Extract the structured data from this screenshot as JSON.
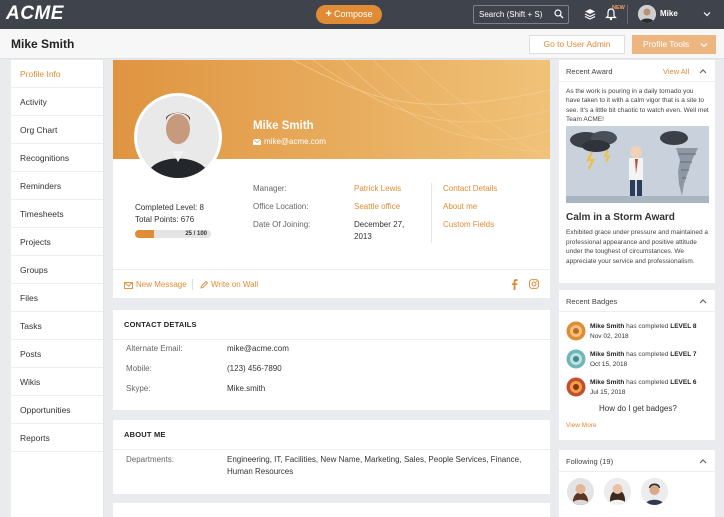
{
  "topbar": {
    "logo": "ACME",
    "compose_label": "Compose",
    "search_placeholder": "Search (Shift + S)",
    "new_badge": "NEW",
    "user_name": "Mike"
  },
  "header": {
    "title": "Mike Smith",
    "goto_admin": "Go to User Admin",
    "profile_tools": "Profile Tools"
  },
  "sidebar": {
    "items": [
      "Profile Info",
      "Activity",
      "Org Chart",
      "Recognitions",
      "Reminders",
      "Timesheets",
      "Projects",
      "Groups",
      "Files",
      "Tasks",
      "Posts",
      "Wikis",
      "Opportunities",
      "Reports"
    ],
    "active_index": 0
  },
  "profile": {
    "name": "Mike Smith",
    "email": "mike@acme.com",
    "completed_level": "Completed Level: 8",
    "total_points": "Total Points: 676",
    "progress_label": "25 / 100",
    "progress_fraction": 0.25,
    "manager_label": "Manager:",
    "manager_value": "Patrick Lewis",
    "office_label": "Office Location:",
    "office_value": "Seattle office",
    "joining_label": "Date Of Joining:",
    "joining_value": "December 27, 2013",
    "links": [
      "Contact Details",
      "About me",
      "Custom Fields"
    ],
    "new_message": "New Message",
    "write_on_wall": "Write on Wall"
  },
  "contact": {
    "title": "CONTACT DETAILS",
    "rows": [
      {
        "label": "Alternate Email:",
        "value": "mike@acme.com"
      },
      {
        "label": "Mobile:",
        "value": "(123) 456-7890"
      },
      {
        "label": "Skype:",
        "value": "Mike.smith"
      }
    ]
  },
  "about": {
    "title": "ABOUT ME",
    "departments_label": "Departments:",
    "departments_value": "Engineering, IT, Facilities, New Name, Marketing, Sales, People Services, Finance, Human Resources"
  },
  "recent_award": {
    "title": "Recent Award",
    "view_all": "View All",
    "text": "As the work is pouring in a daily tornado you have taken to it with a calm vigor that is a site to see. It's a little bit chaotic to watch even. Well met Team ACME!",
    "award_name": "Calm in a Storm Award",
    "award_desc": "Exhibited grace under pressure and maintained a professional appearance and positive attitude under the toughest of circumstances. We appreciate your service and professionalism."
  },
  "recent_badges": {
    "title": "Recent Badges",
    "has_completed": "has completed",
    "items": [
      {
        "name": "Mike Smith",
        "level": "LEVEL 8",
        "date": "Nov 02, 2018",
        "color": "#e08c37"
      },
      {
        "name": "Mike Smith",
        "level": "LEVEL 7",
        "date": "Oct 15, 2018",
        "color": "#6fb6b8"
      },
      {
        "name": "Mike Smith",
        "level": "LEVEL 6",
        "date": "Jul 15, 2018",
        "color": "#c1502e"
      }
    ],
    "how_to": "How do I get badges?",
    "view_more": "View More"
  },
  "following": {
    "title": "Following (19)"
  },
  "colors": {
    "accent": "#e08c37",
    "topbar": "#3f434b",
    "banner_start": "#e39a45",
    "banner_end": "#f0c277"
  }
}
